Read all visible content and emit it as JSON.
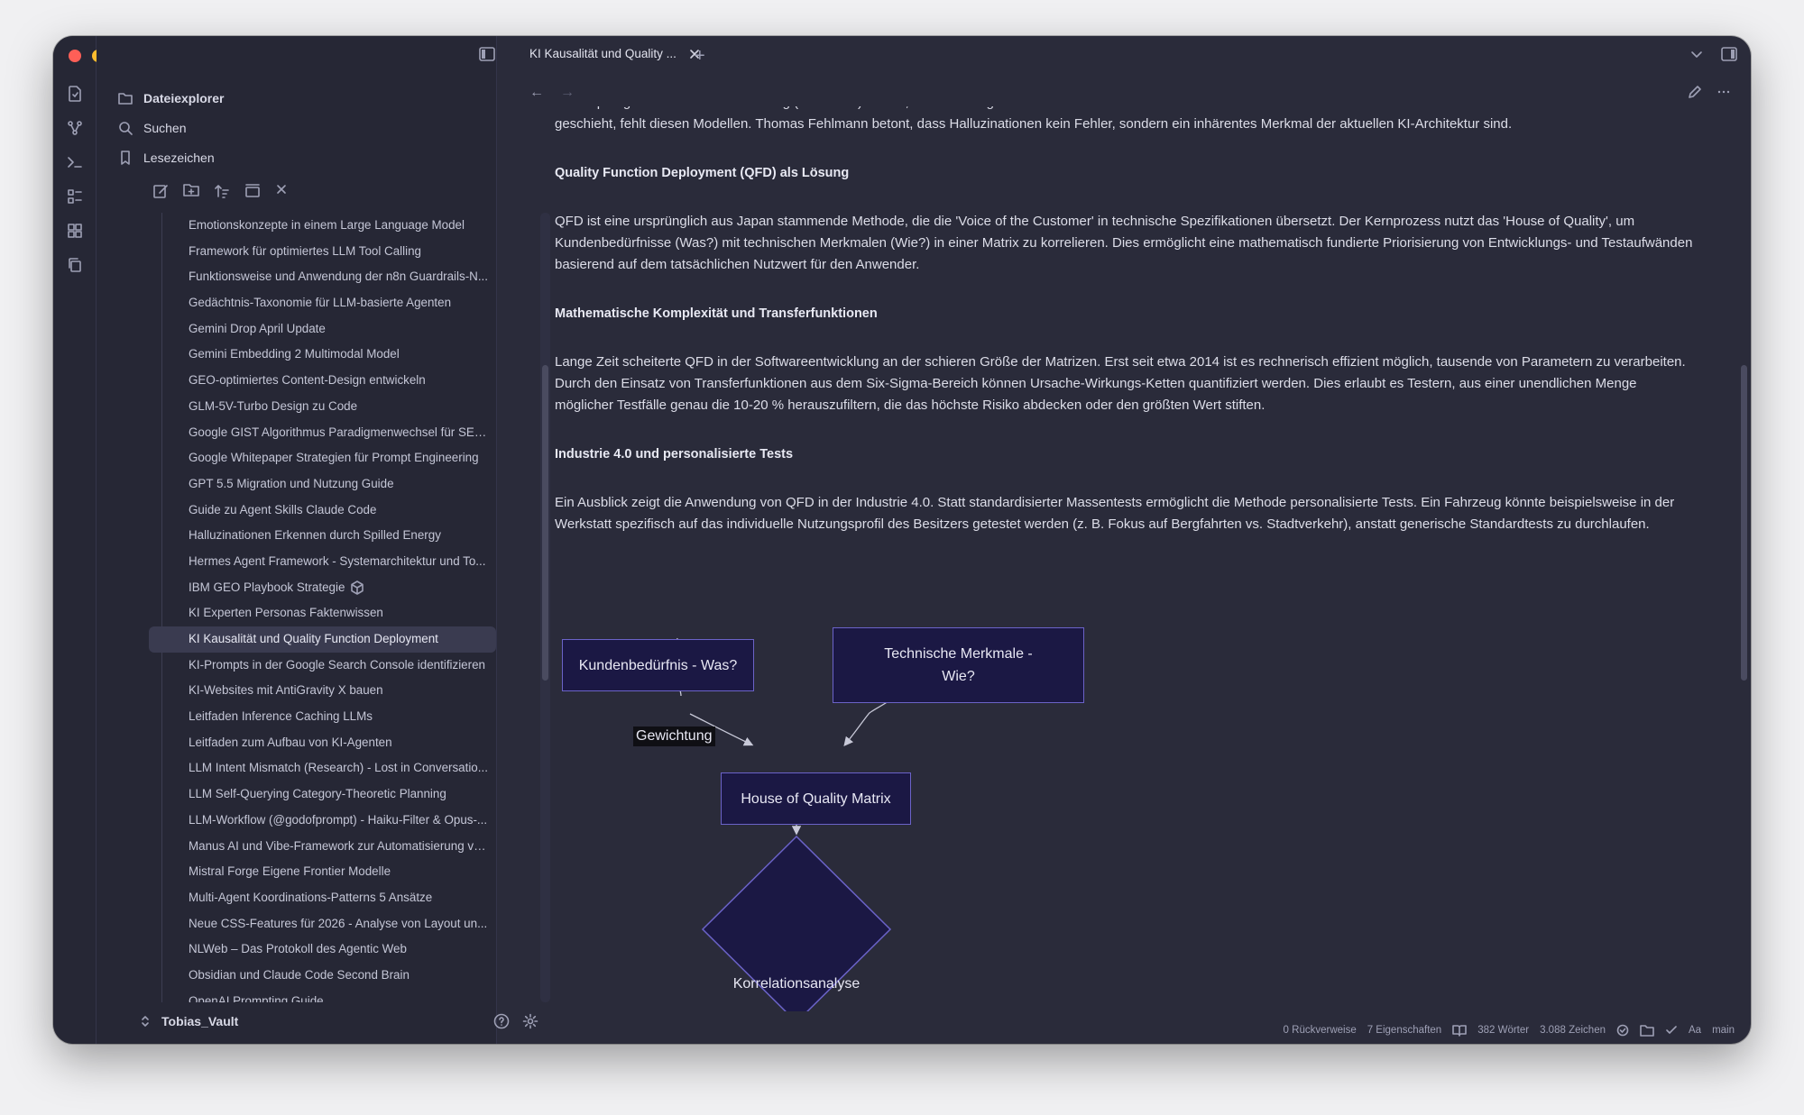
{
  "sidebar": {
    "nav": [
      {
        "label": "Dateiexplorer",
        "icon": "folder-icon"
      },
      {
        "label": "Suchen",
        "icon": "search-icon"
      },
      {
        "label": "Lesezeichen",
        "icon": "bookmark-icon"
      }
    ],
    "files": [
      "Emotionskonzepte in einem Large Language Model",
      "Framework für optimiertes LLM Tool Calling",
      "Funktionsweise und Anwendung der n8n Guardrails-N...",
      "Gedächtnis-Taxonomie für LLM-basierte Agenten",
      "Gemini Drop April Update",
      "Gemini Embedding 2 Multimodal Model",
      "GEO-optimiertes Content-Design entwickeln",
      "GLM-5V-Turbo Design zu Code",
      "Google GIST Algorithmus Paradigmenwechsel für SEO ...",
      "Google Whitepaper Strategien für Prompt Engineering",
      "GPT 5.5 Migration und Nutzung Guide",
      "Guide zu Agent Skills Claude Code",
      "Halluzinationen Erkennen durch Spilled Energy",
      "Hermes Agent Framework - Systemarchitektur und To...",
      "IBM GEO Playbook Strategie",
      "KI Experten Personas Faktenwissen",
      "KI Kausalität und Quality Function Deployment",
      "KI-Prompts in der Google Search Console identifizieren",
      "KI-Websites mit AntiGravity X bauen",
      "Leitfaden Inference Caching LLMs",
      "Leitfaden zum Aufbau von KI-Agenten",
      "LLM Intent Mismatch (Research) - Lost in Conversatio...",
      "LLM Self-Querying Category-Theoretic Planning",
      "LLM-Workflow (@godofprompt) - Haiku-Filter & Opus-...",
      "Manus AI und Vibe-Framework zur Automatisierung vo...",
      "Mistral Forge Eigene Frontier Modelle",
      "Multi-Agent Koordinations-Patterns 5 Ansätze",
      "Neue CSS-Features für 2026 - Analyse von Layout un...",
      "NLWeb – Das Protokoll des Agentic Web",
      "Obsidian und Claude Code Second Brain",
      "OpenAI Prompting Guide"
    ],
    "active_index": 16,
    "vault_name": "Tobias_Vault"
  },
  "tab": {
    "title": "KI Kausalität und Quality ..."
  },
  "document": {
    "intro_clipped": "Verknüpfung von Ursache und Wirkung (Kausalität) besitzt, sondern lediglich Wahrscheinlichkeiten innerhalb eines Vektorraums berechnet. Ein echtes Verständnis für 'Warum' etwas geschieht, fehlt diesen Modellen. Thomas Fehlmann betont, dass Halluzinationen kein Fehler, sondern ein inhärentes Merkmal der aktuellen KI-Architektur sind.",
    "h1": "Quality Function Deployment (QFD) als Lösung",
    "p1": "QFD ist eine ursprünglich aus Japan stammende Methode, die die 'Voice of the Customer' in technische Spezifikationen übersetzt. Der Kernprozess nutzt das 'House of Quality', um Kundenbedürfnisse (Was?) mit technischen Merkmalen (Wie?) in einer Matrix zu korrelieren. Dies ermöglicht eine mathematisch fundierte Priorisierung von Entwicklungs- und Testaufwänden basierend auf dem tatsächlichen Nutzwert für den Anwender.",
    "h2": "Mathematische Komplexität und Transferfunktionen",
    "p2": "Lange Zeit scheiterte QFD in der Softwareentwicklung an der schieren Größe der Matrizen. Erst seit etwa 2014 ist es rechnerisch effizient möglich, tausende von Parametern zu verarbeiten. Durch den Einsatz von Transferfunktionen aus dem Six-Sigma-Bereich können Ursache-Wirkungs-Ketten quantifiziert werden. Dies erlaubt es Testern, aus einer unendlichen Menge möglicher Testfälle genau die 10-20 % herauszufiltern, die das höchste Risiko abdecken oder den größten Wert stiften.",
    "h3": "Industrie 4.0 und personalisierte Tests",
    "p3": "Ein Ausblick zeigt die Anwendung von QFD in der Industrie 4.0. Statt standardisierter Massentests ermöglicht die Methode personalisierte Tests. Ein Fahrzeug könnte beispielsweise in der Werkstatt spezifisch auf das individuelle Nutzungsprofil des Besitzers getestet werden (z. B. Fokus auf Bergfahrten vs. Stadtverkehr), anstatt generische Standardtests zu durchlaufen."
  },
  "diagram": {
    "node_was": "Kundenbedürfnis - Was?",
    "node_wie_line1": "Technische Merkmale -",
    "node_wie_line2": "Wie?",
    "edge_label": "Gewichtung",
    "node_matrix": "House of Quality Matrix",
    "node_korrelation": "Korrelationsanalyse"
  },
  "status": {
    "backlinks": "0 Rückverweise",
    "properties": "7 Eigenschaften",
    "words": "382 Wörter",
    "chars": "3.088 Zeichen",
    "font": "Aa",
    "branch": "main"
  },
  "colors": {
    "window_bg": "#2a2b3a",
    "sidebar_bg": "#262735",
    "node_fill": "#1b1844",
    "node_border": "#6b63c8"
  }
}
